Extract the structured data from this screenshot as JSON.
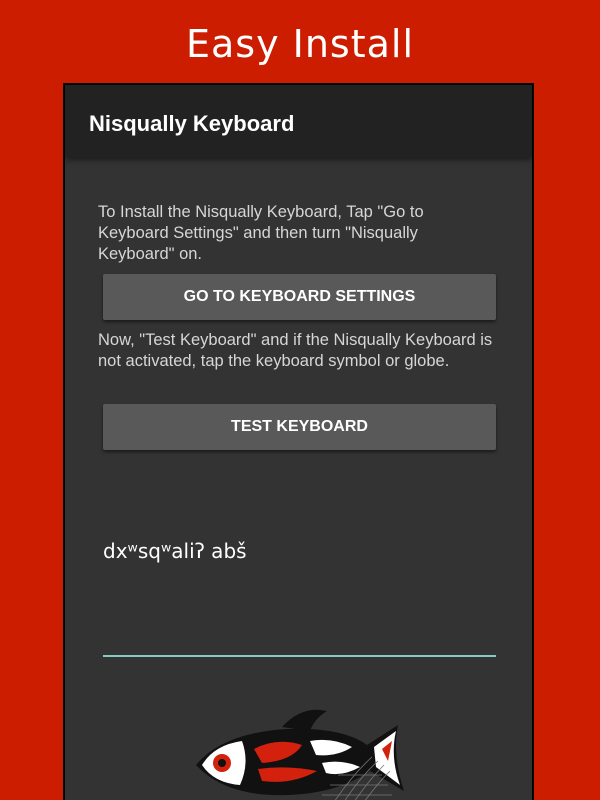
{
  "banner": {
    "title": "Easy Install"
  },
  "app": {
    "title": "Nisqually Keyboard",
    "instructions_install": "To Install the Nisqually Keyboard, Tap \"Go to Keyboard Settings\" and then turn \"Nisqually Keyboard\" on.",
    "go_to_settings_label": "GO TO KEYBOARD SETTINGS",
    "instructions_test": "Now, \"Test Keyboard\" and if the Nisqually Keyboard is not activated, tap the keyboard symbol or globe.",
    "test_keyboard_label": "TEST KEYBOARD",
    "test_input_value": "dxʷsqʷaliʔ abš"
  },
  "colors": {
    "background": "#cc1d00",
    "screen": "#333333",
    "appbar": "#222222",
    "button": "#595959",
    "accent_underline": "#80cbc4"
  },
  "icons": {
    "logo": "salmon-logo"
  }
}
